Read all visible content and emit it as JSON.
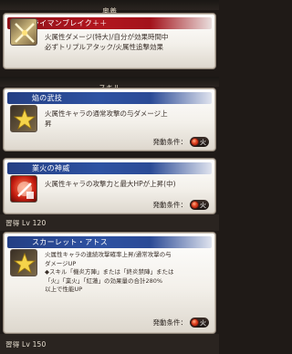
{
  "sections": {
    "ougi": "奥義",
    "skill": "スキル"
  },
  "ougi": {
    "name": "ライマンブレイク＋＋",
    "description": "火属性ダメージ(特大)/自分が効果時間中\n必ずトリプルアタック/火属性追撃効果"
  },
  "skills": [
    {
      "name": "焔の武技",
      "icon": "gold-star-icon",
      "description": "火属性キャラの通常攻撃の与ダメージ上\n昇",
      "trigger_label": "発動条件：",
      "trigger_value": "火"
    },
    {
      "name": "業火の神威",
      "icon": "red-fire-attack-icon",
      "description": "火属性キャラの攻撃力と最大HPが上昇(中)",
      "trigger_label": "発動条件：",
      "trigger_value": "火",
      "learn": "習得 Lv 120"
    },
    {
      "name": "スカーレット・アトス",
      "icon": "gold-star-icon",
      "description": "火属性キャラの連続攻撃確率上昇/通常攻撃の与\nダメージUP\n◆スキル「機炎方陣」または「終炎禁陣」または\n「火」「業火」「紅蓮」の効果量の合計280%\n以上で性能UP",
      "trigger_label": "発動条件：",
      "trigger_value": "火",
      "learn": "習得 Lv 150"
    }
  ],
  "colors": {
    "ougi_title": "#b2161f",
    "skill_title": "#2e52a2",
    "fire": "#e0411f"
  }
}
